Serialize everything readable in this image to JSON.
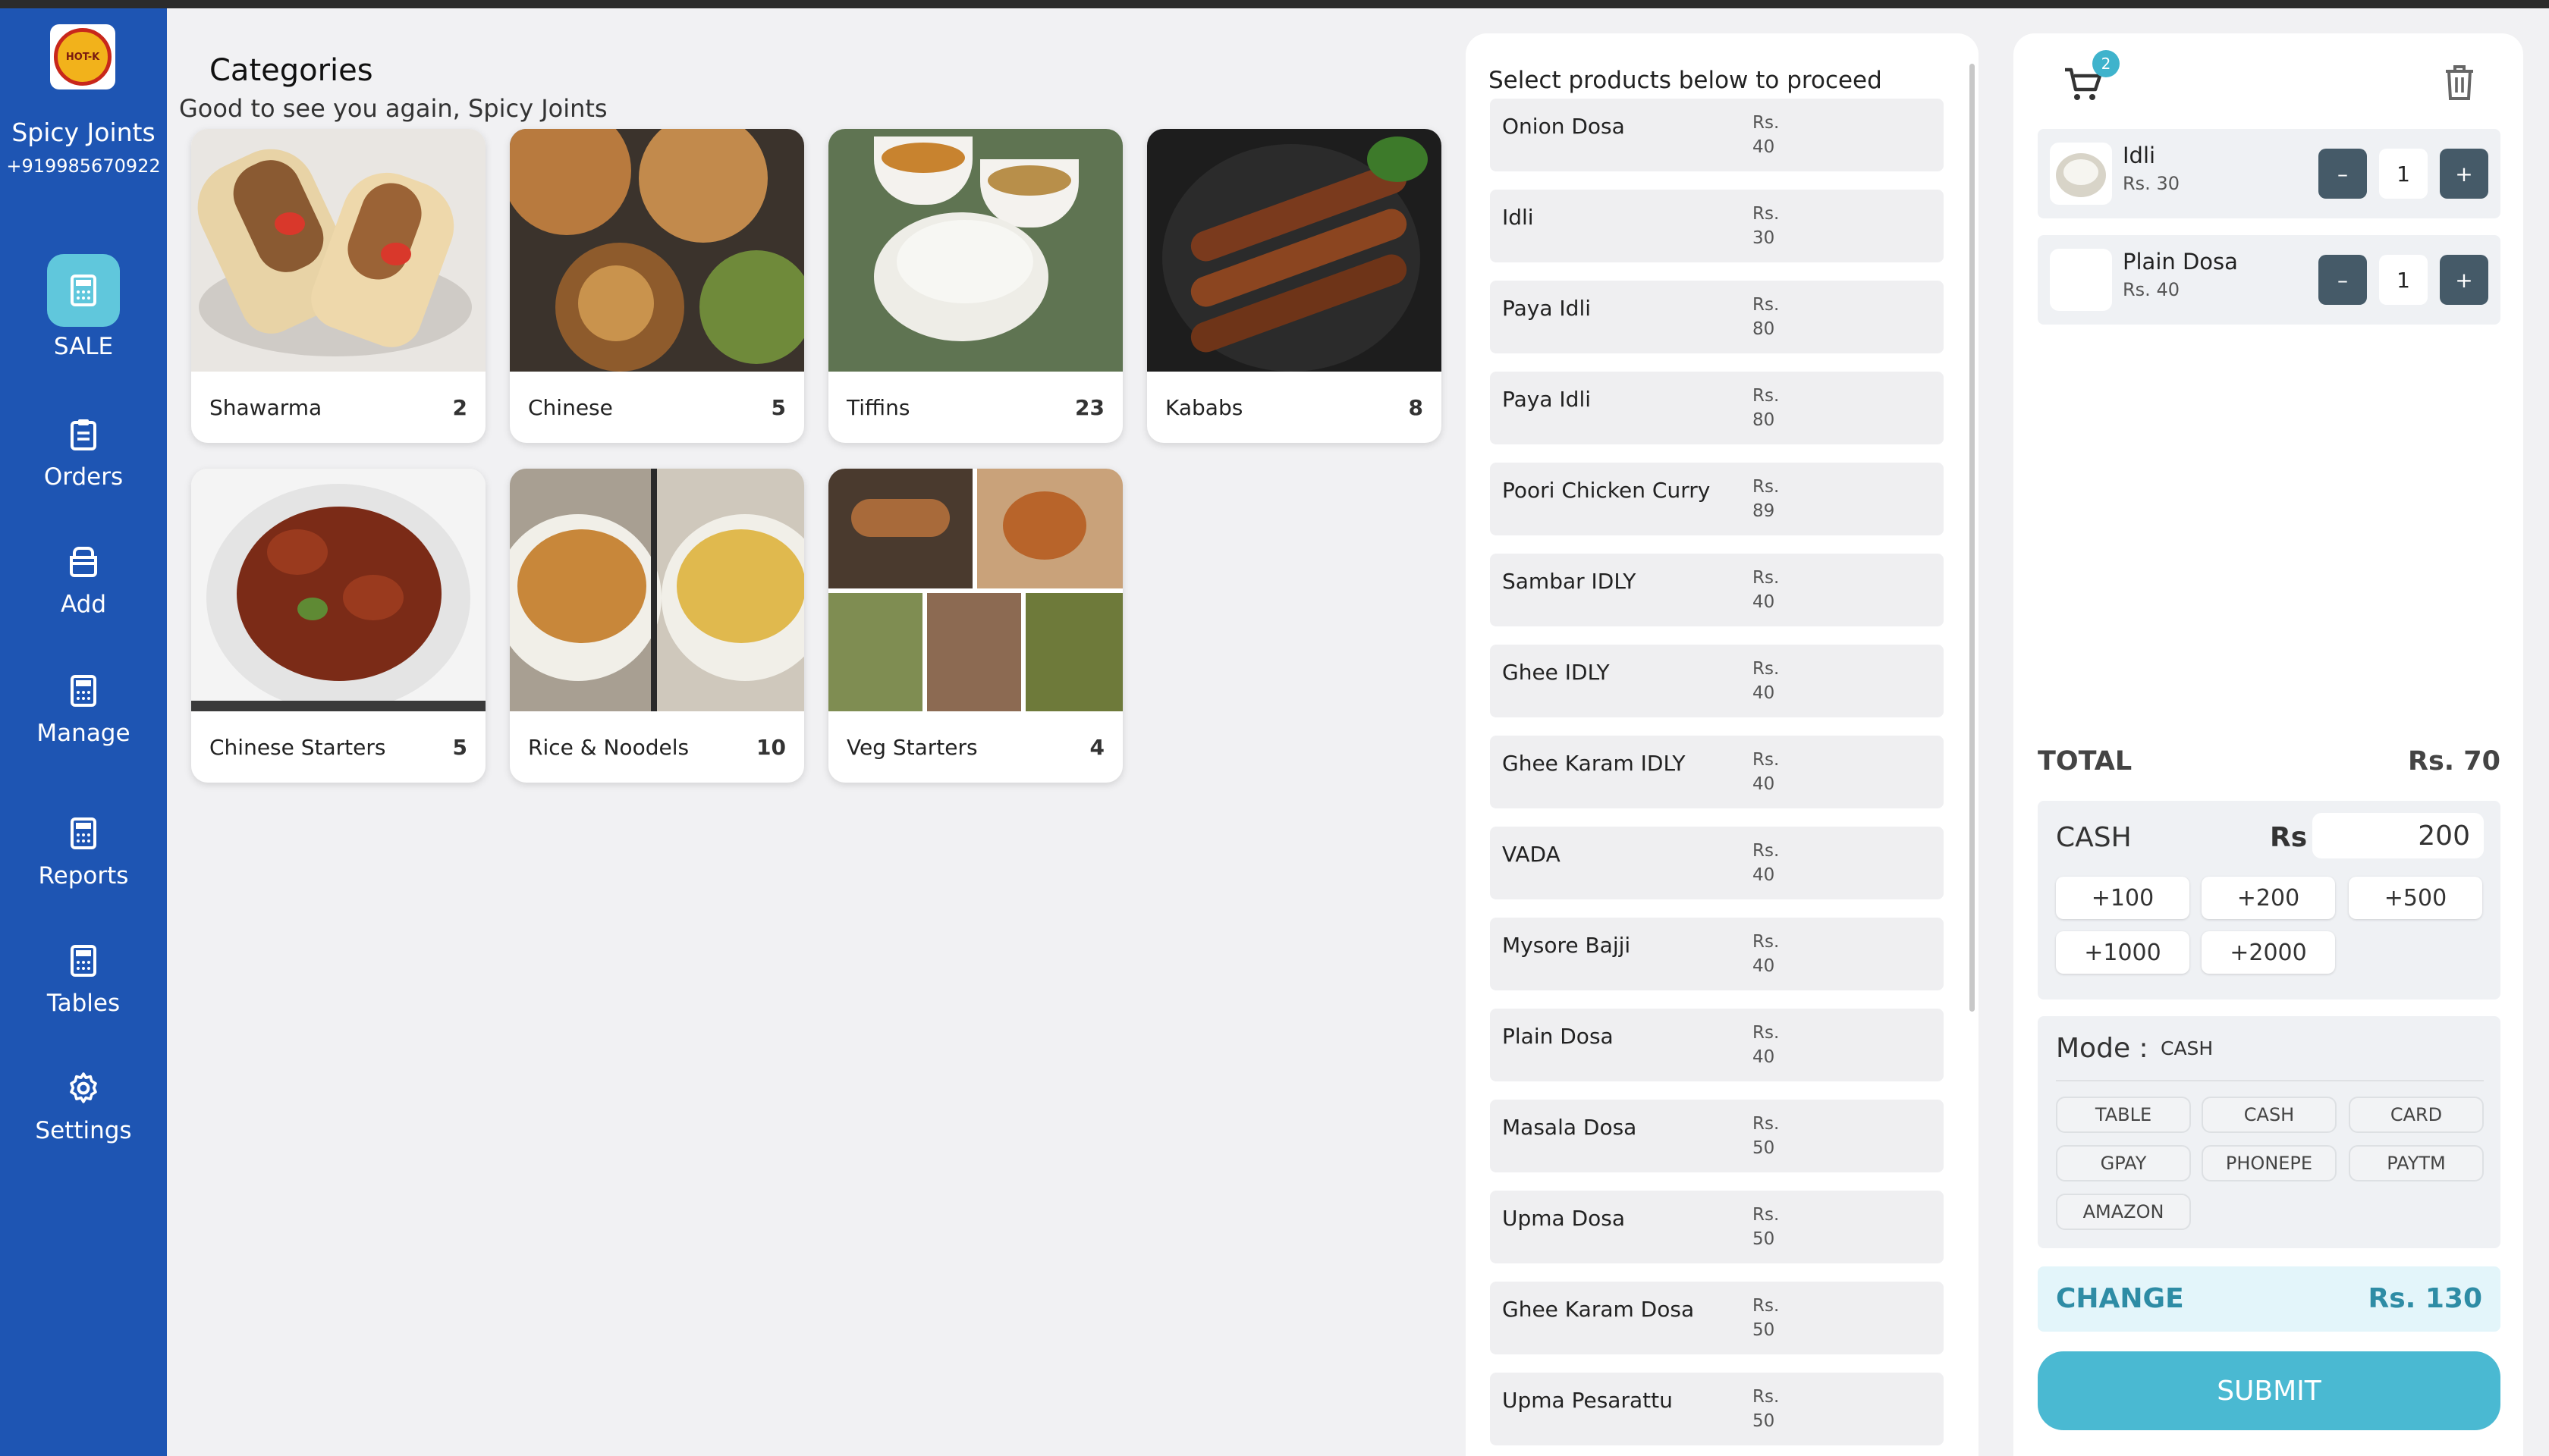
{
  "store": {
    "name": "Spicy Joints",
    "phone": "+919985670922",
    "logo_text": "HOT-K"
  },
  "nav": [
    {
      "label": "SALE",
      "icon": "calculator-icon",
      "active": true
    },
    {
      "label": "Orders",
      "icon": "clipboard-icon"
    },
    {
      "label": "Add",
      "icon": "box-icon"
    },
    {
      "label": "Manage",
      "icon": "calculator-icon"
    },
    {
      "label": "Reports",
      "icon": "calculator-icon"
    },
    {
      "label": "Tables",
      "icon": "calculator-icon"
    },
    {
      "label": "Settings",
      "icon": "gear-icon"
    }
  ],
  "main": {
    "title": "Categories",
    "greeting": "Good to see you again, Spicy Joints",
    "categories": [
      {
        "name": "Shawarma",
        "count": "2"
      },
      {
        "name": "Chinese",
        "count": "5"
      },
      {
        "name": "Tiffins",
        "count": "23"
      },
      {
        "name": "Kababs",
        "count": "8"
      },
      {
        "name": "Chinese Starters",
        "count": "5"
      },
      {
        "name": "Rice & Noodels",
        "count": "10"
      },
      {
        "name": "Veg Starters",
        "count": "4"
      }
    ]
  },
  "products": {
    "heading": "Select products below to proceed",
    "items": [
      {
        "name": "Onion Dosa",
        "currency": "Rs.",
        "price": "40"
      },
      {
        "name": "Idli",
        "currency": "Rs.",
        "price": "30"
      },
      {
        "name": "Paya Idli",
        "currency": "Rs.",
        "price": "80"
      },
      {
        "name": "Paya Idli",
        "currency": "Rs.",
        "price": "80"
      },
      {
        "name": "Poori Chicken Curry",
        "currency": "Rs.",
        "price": "89"
      },
      {
        "name": "Sambar IDLY",
        "currency": "Rs.",
        "price": "40"
      },
      {
        "name": "Ghee IDLY",
        "currency": "Rs.",
        "price": "40"
      },
      {
        "name": "Ghee Karam IDLY",
        "currency": "Rs.",
        "price": "40"
      },
      {
        "name": "VADA",
        "currency": "Rs.",
        "price": "40"
      },
      {
        "name": "Mysore Bajji",
        "currency": "Rs.",
        "price": "40"
      },
      {
        "name": "Plain Dosa",
        "currency": "Rs.",
        "price": "40"
      },
      {
        "name": "Masala Dosa",
        "currency": "Rs.",
        "price": "50"
      },
      {
        "name": "Upma Dosa",
        "currency": "Rs.",
        "price": "50"
      },
      {
        "name": "Ghee Karam Dosa",
        "currency": "Rs.",
        "price": "50"
      },
      {
        "name": "Upma Pesarattu",
        "currency": "Rs.",
        "price": "50"
      }
    ]
  },
  "cart": {
    "badge": "2",
    "items": [
      {
        "name": "Idli",
        "price": "Rs. 30",
        "qty": "1",
        "minus": "–",
        "plus": "+"
      },
      {
        "name": "Plain Dosa",
        "price": "Rs. 40",
        "qty": "1",
        "minus": "–",
        "plus": "+"
      }
    ],
    "total_label": "TOTAL",
    "total_value": "Rs. 70",
    "cash_label": "CASH",
    "cash_currency": "Rs",
    "cash_value": "200",
    "quick_amounts": [
      "+100",
      "+200",
      "+500",
      "+1000",
      "+2000"
    ],
    "mode_label": "Mode :",
    "mode_value": "CASH",
    "modes": [
      "TABLE",
      "CASH",
      "CARD",
      "GPAY",
      "PHONEPE",
      "PAYTM",
      "AMAZON"
    ],
    "change_label": "CHANGE",
    "change_value": "Rs. 130",
    "submit_label": "SUBMIT"
  },
  "colors": {
    "sidebar": "#1e55b3",
    "accent": "#4ab9d2",
    "active_tile": "#60c7dc",
    "qty_button": "#455a68"
  }
}
